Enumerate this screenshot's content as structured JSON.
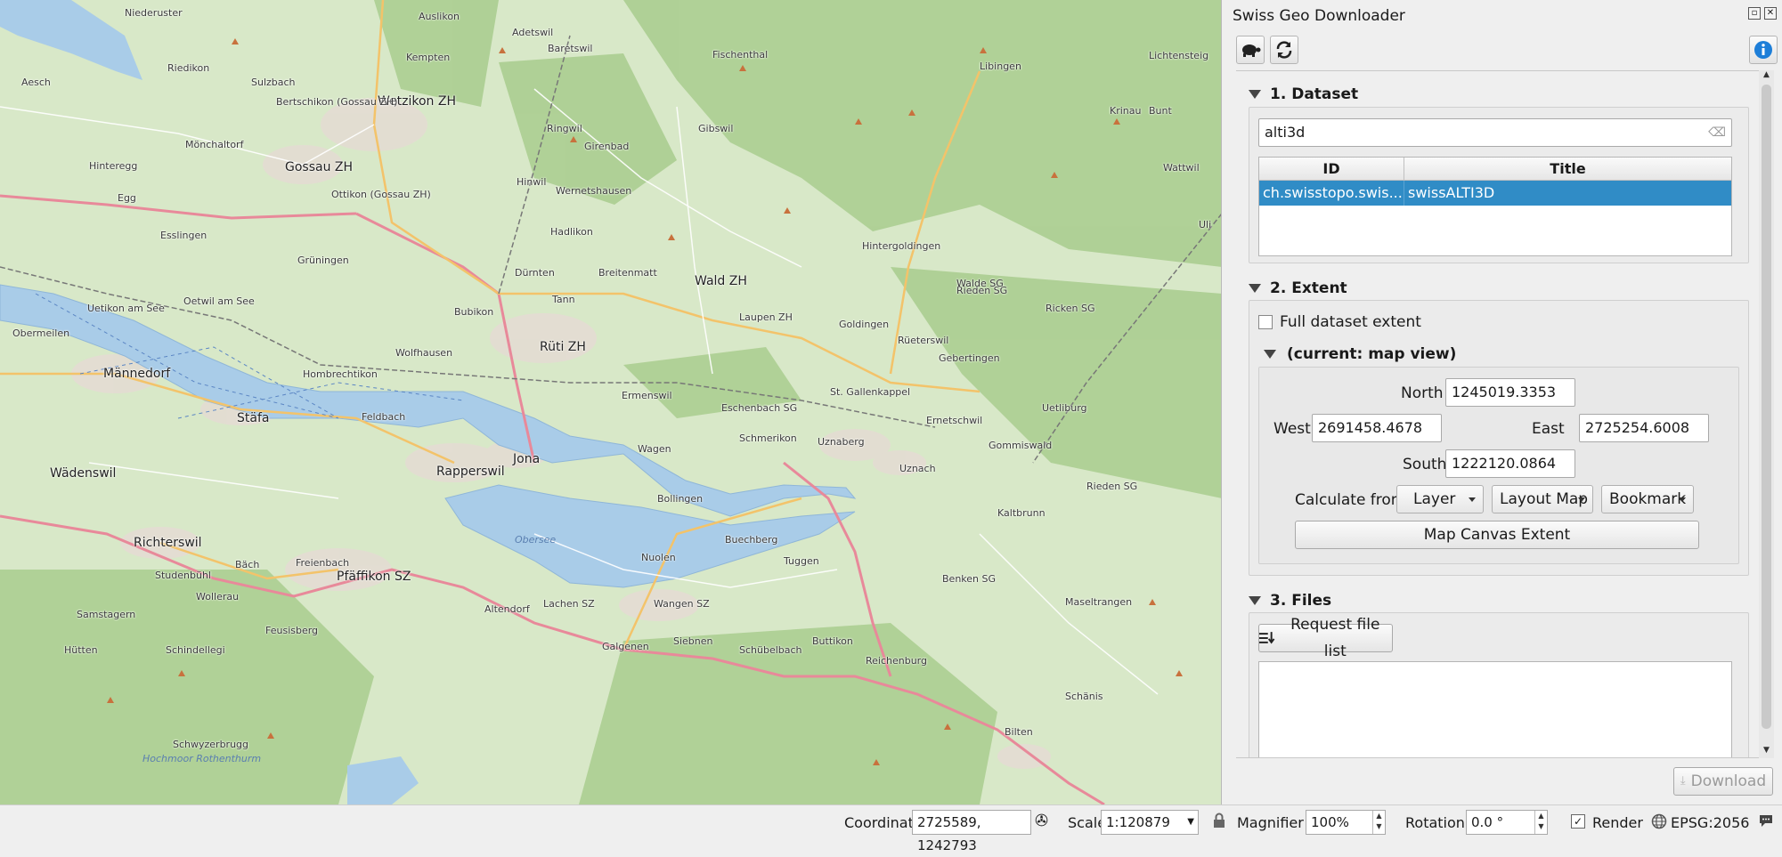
{
  "panel": {
    "title": "Swiss Geo Downloader",
    "sections": {
      "dataset": {
        "heading": "1. Dataset",
        "search_value": "alti3d",
        "columns": [
          "ID",
          "Title"
        ],
        "rows": [
          {
            "id": "ch.swisstopo.swis...",
            "title": "swissALTI3D"
          }
        ]
      },
      "extent": {
        "heading": "2. Extent",
        "full_extent_label": "Full dataset extent",
        "sub_heading": "(current: map view)",
        "north_label": "North",
        "north_value": "1245019.3353",
        "west_label": "West",
        "west_value": "2691458.4678",
        "east_label": "East",
        "east_value": "2725254.6008",
        "south_label": "South",
        "south_value": "1222120.0864",
        "calc_label": "Calculate from",
        "calc_options": [
          "Layer",
          "Layout Map",
          "Bookmark"
        ],
        "canvas_button": "Map Canvas Extent"
      },
      "files": {
        "heading": "3. Files",
        "request_button": "Request file list"
      }
    },
    "download_button": "Download"
  },
  "statusbar": {
    "coordinate_label": "Coordinate",
    "coordinate_value": "2725589, 1242793",
    "scale_label": "Scale",
    "scale_value": "1:120879",
    "magnifier_label": "Magnifier",
    "magnifier_value": "100%",
    "rotation_label": "Rotation",
    "rotation_value": "0.0 °",
    "render_label": "Render",
    "crs": "EPSG:2056"
  },
  "map": {
    "labels": [
      "Niederuster",
      "Auslikon",
      "Adetswil",
      "Baretswil",
      "Fischenthal",
      "Libingen",
      "Lichtensteig",
      "Kempten",
      "Wetzikon ZH",
      "Riedikon",
      "Gossau ZH",
      "Hinteregg",
      "Egg",
      "Mönchaltorf",
      "Esslingen",
      "Grüningen",
      "Hinwil",
      "Wernetshausen",
      "Hadlikon",
      "Dürnten",
      "Tann",
      "Wald ZH",
      "Hintergoldingen",
      "Oetwil am See",
      "Uetikon am See",
      "Bubikon",
      "Rüti ZH",
      "Laupen ZH",
      "Goldingen",
      "Rieden SG",
      "Obermeilen",
      "Männedorf",
      "Wolfhausen",
      "Hombrechtikon",
      "Ermenswil",
      "Eschenbach SG",
      "St. Gallenkappel",
      "Rüeterswil",
      "Gebertingen",
      "Ernetschwil",
      "Stäfa",
      "Feldbach",
      "Rapperswil",
      "Jona",
      "Wagen",
      "Uznaberg",
      "Uetliburg",
      "Gommiswald",
      "Wädenswil",
      "Schmerikon",
      "Uznach",
      "Kaltbrunn",
      "Rieden SG",
      "Richterswil",
      "Bollingen",
      "Obersee",
      "Buechberg",
      "Nuolen",
      "Tuggen",
      "Benken SG",
      "Bäch",
      "Freienbach",
      "Pfäffikon SZ",
      "Wollerau",
      "Altendorf",
      "Lachen SZ",
      "Wangen SZ",
      "Maseltrangen",
      "Samstagern",
      "Feusisberg",
      "Galgenen",
      "Siebnen",
      "Schübelbach",
      "Buttikon",
      "Reichenburg",
      "Schänis",
      "Hütten",
      "Schindellegi",
      "Bilten",
      "Schwyzerbrugg",
      "Hochmoor Rothenthurm",
      "Ricken SG",
      "Aesch",
      "Sulzbach",
      "Bertschikon (Gossau ZH)",
      "Ottikon (Gossau ZH)",
      "Ringwil",
      "Girenbad",
      "Gibswil",
      "Breitenmatt",
      "Studenbühl",
      "Krinau",
      "Bunt",
      "Wattwil",
      "Walde SG",
      "Uli"
    ]
  }
}
